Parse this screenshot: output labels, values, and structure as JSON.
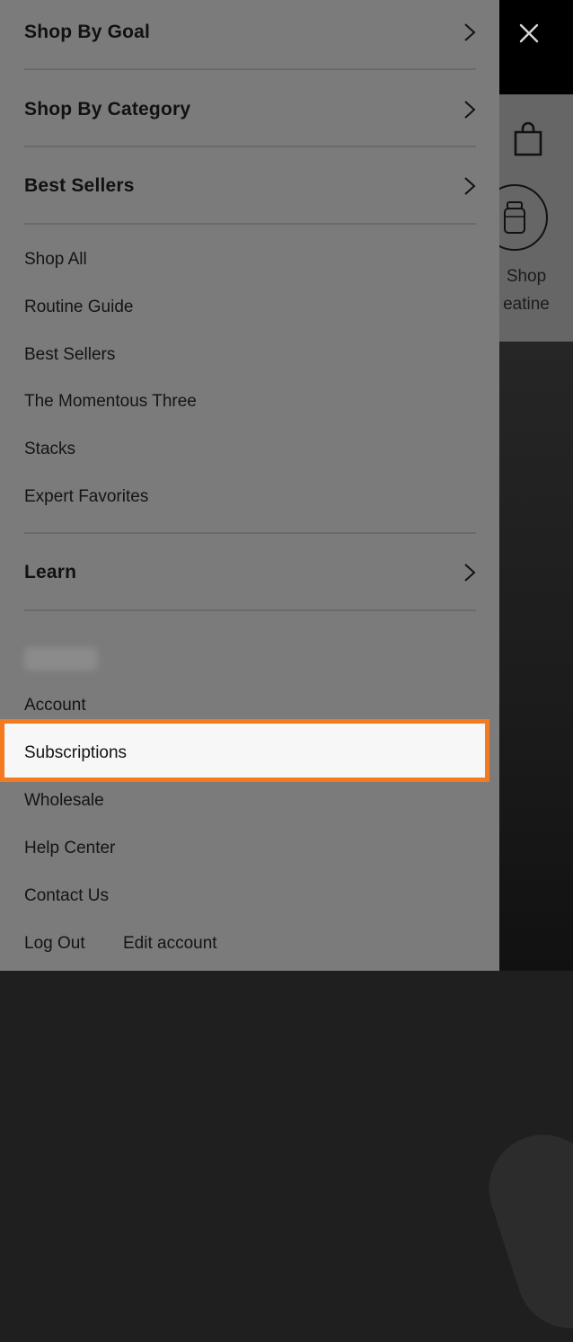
{
  "drawer": {
    "sections": [
      {
        "label": "Shop By Goal"
      },
      {
        "label": "Shop By Category"
      },
      {
        "label": "Best Sellers"
      }
    ],
    "links": [
      {
        "label": "Shop All"
      },
      {
        "label": "Routine Guide"
      },
      {
        "label": "Best Sellers"
      },
      {
        "label": "The Momentous Three"
      },
      {
        "label": "Stacks"
      },
      {
        "label": "Expert Favorites"
      }
    ],
    "learn": {
      "label": "Learn"
    },
    "account_links": [
      {
        "label": "Account"
      },
      {
        "label": "Subscriptions"
      },
      {
        "label": "Wholesale"
      },
      {
        "label": "Help Center"
      },
      {
        "label": "Contact Us"
      }
    ],
    "footer": {
      "logout": "Log Out",
      "edit_account": "Edit account"
    }
  },
  "background": {
    "shop_label": "Shop",
    "category_label_partial": "eatine"
  },
  "icons": {
    "close": "close-icon",
    "bag": "shopping-bag-icon",
    "chevron": "chevron-right-icon",
    "product": "supplement-jar-icon"
  },
  "colors": {
    "highlight_border": "#f47a20",
    "drawer_overlay": "#7b7b7b",
    "highlight_fill": "#f7f7f7"
  }
}
